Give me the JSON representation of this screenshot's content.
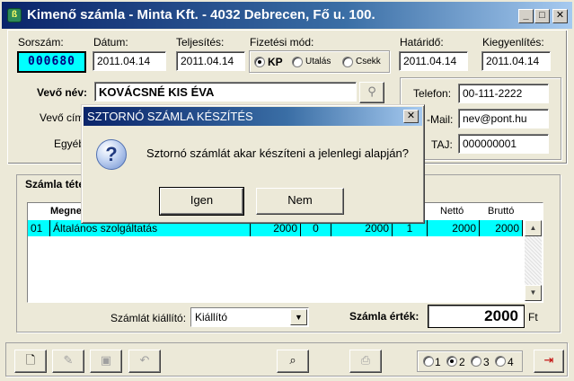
{
  "window": {
    "title": "Kimenő számla - Minta Kft. - 4032 Debrecen, Fő u. 100.",
    "btn_min": "_",
    "btn_max": "□",
    "btn_close": "✕"
  },
  "header": {
    "sorszam_label": "Sorszám:",
    "sorszam_value": "000680",
    "datum_label": "Dátum:",
    "datum_value": "2011.04.14",
    "teljesites_label": "Teljesítés:",
    "teljesites_value": "2011.04.14",
    "fizetesi_mod_label": "Fizetési mód:",
    "payment_options": [
      "KP",
      "Utalás",
      "Csekk"
    ],
    "payment_selected": "KP",
    "hatarido_label": "Határidő:",
    "hatarido_value": "2011.04.14",
    "kiegyenlites_label": "Kiegyenlítés:",
    "kiegyenlites_value": "2011.04.14"
  },
  "customer": {
    "vevo_nev_label": "Vevő név:",
    "vevo_nev_value": "KOVÁCSNÉ KIS ÉVA",
    "vevo_cim_label": "Vevő cím",
    "egyeb_label": "Egyéb"
  },
  "contact": {
    "telefon_label": "Telefon:",
    "telefon_value": "00-111-2222",
    "email_label": "-Mail:",
    "email_value": "nev@pont.hu",
    "taj_label": "TAJ:",
    "taj_value": "000000001"
  },
  "dialog": {
    "title": "SZTORNÓ SZÁMLA KÉSZÍTÉS",
    "close": "✕",
    "icon_glyph": "?",
    "message": "Sztornó számlát akar készíteni a jelenlegi alapján?",
    "yes_label": "Igen",
    "no_label": "Nem"
  },
  "items": {
    "section_label": "Számla téte",
    "columns": {
      "megnevezes": "Megne",
      "netto": "Nettó",
      "brutto": "Bruttó"
    },
    "rows": [
      {
        "num": "01",
        "name": "Általános szolgáltatás",
        "c3": "2000",
        "c4": "0",
        "c5": "2000",
        "c6": "1",
        "netto": "2000",
        "brutto": "2000"
      }
    ]
  },
  "footer": {
    "kiallito_label": "Számlát kiállító:",
    "kiallito_value": "Kiállító",
    "ertek_label": "Számla érték:",
    "ertek_value": "2000",
    "currency": "Ft"
  },
  "toolbar": {
    "page_options": [
      "1",
      "2",
      "3",
      "4"
    ],
    "page_selected": "2",
    "icons": [
      "new-document-icon",
      "edit-icon",
      "save-icon",
      "undo-icon",
      "print-preview-icon",
      "print-icon",
      "exit-icon"
    ]
  },
  "colors": {
    "titlebar_start": "#0a246a",
    "titlebar_end": "#a6caf0",
    "row_highlight": "#00ffff",
    "face": "#ece9d8"
  }
}
